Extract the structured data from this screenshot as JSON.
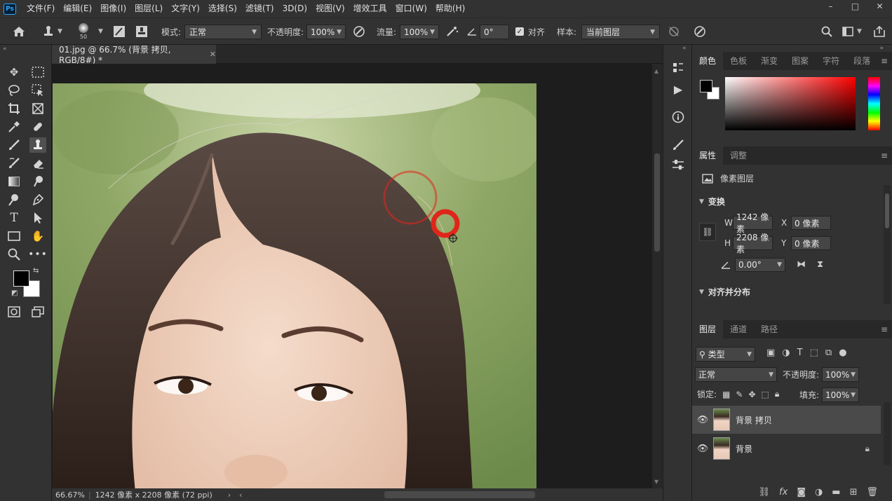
{
  "app": {
    "logo": "Ps"
  },
  "menu": [
    "文件(F)",
    "编辑(E)",
    "图像(I)",
    "图层(L)",
    "文字(Y)",
    "选择(S)",
    "滤镜(T)",
    "3D(D)",
    "视图(V)",
    "增效工具",
    "窗口(W)",
    "帮助(H)"
  ],
  "window": {
    "min": "–",
    "max": "□",
    "close": "✕"
  },
  "options": {
    "brush_size": "50",
    "mode_label": "模式:",
    "mode_value": "正常",
    "opacity_label": "不透明度:",
    "opacity_value": "100%",
    "flow_label": "流量:",
    "flow_value": "100%",
    "angle_value": "0°",
    "aligned_label": "对齐",
    "aligned_checked": true,
    "sample_label": "样本:",
    "sample_value": "当前图层"
  },
  "document": {
    "tab_title": "01.jpg @ 66.7% (背景 拷贝, RGB/8#) *",
    "zoom": "66.67%",
    "info": "1242 像素 x 2208 像素 (72 ppi)"
  },
  "color_panel": {
    "tabs": [
      "颜色",
      "色板",
      "渐变",
      "图案",
      "字符",
      "段落"
    ],
    "active": "颜色"
  },
  "properties_panel": {
    "tabs": [
      "属性",
      "调整"
    ],
    "layer_type": "像素图层",
    "transform_title": "变换",
    "w_label": "W",
    "w_value": "1242 像素",
    "h_label": "H",
    "h_value": "2208 像素",
    "x_label": "X",
    "x_value": "0 像素",
    "y_label": "Y",
    "y_value": "0 像素",
    "angle_value": "0.00°",
    "align_title": "对齐并分布"
  },
  "layers_panel": {
    "tabs": [
      "图层",
      "通道",
      "路径"
    ],
    "filter_label": "类型",
    "blend_mode": "正常",
    "opacity_label": "不透明度:",
    "opacity_value": "100%",
    "lock_label": "锁定:",
    "fill_label": "填充:",
    "fill_value": "100%",
    "layers": [
      {
        "name": "背景 拷贝",
        "selected": true,
        "locked": false
      },
      {
        "name": "背景",
        "selected": false,
        "locked": true
      }
    ]
  },
  "colors": {
    "foreground": "#000000",
    "background": "#ffffff",
    "brush_cursor": "#e0261a"
  }
}
